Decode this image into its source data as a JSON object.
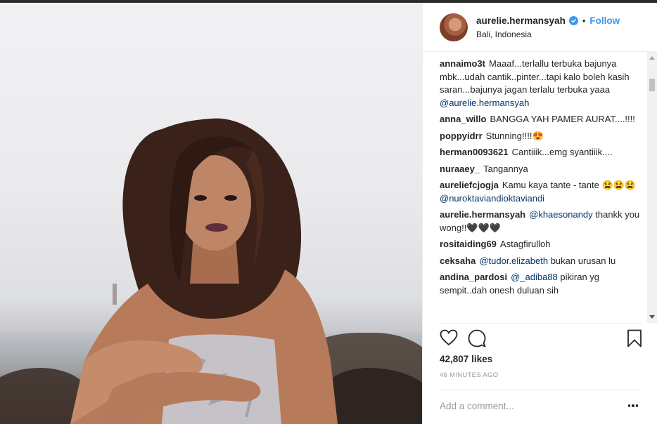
{
  "post": {
    "username": "aurelie.hermansyah",
    "verified_icon": "verified-badge-icon",
    "separator": "•",
    "follow_label": "Follow",
    "location": "Bali, Indonesia"
  },
  "comments": [
    {
      "user": "annaimo3t",
      "text": "Maaaf...terlallu terbuka bajunya mbk...udah cantik..pinter...tapi kalo boleh kasih saran...bajunya jagan terlalu terbuka yaaa ",
      "mention": "@aurelie.hermansyah",
      "after": ""
    },
    {
      "user": "anna_willo",
      "text": "BANGGA YAH PAMER AURAT....!!!!",
      "mention": "",
      "after": ""
    },
    {
      "user": "poppyidrr",
      "text": "Stunning!!!!😍",
      "mention": "",
      "after": ""
    },
    {
      "user": "herman0093621",
      "text": "Cantiiik...emg syantiiik....",
      "mention": "",
      "after": ""
    },
    {
      "user": "nuraaey_",
      "text": "Tangannya",
      "mention": "",
      "after": ""
    },
    {
      "user": "aureliefcjogja",
      "text": "Kamu kaya tante - tante 😫😫😫",
      "mention": "@nuroktaviandioktaviandi",
      "after": ""
    },
    {
      "user": "aurelie.hermansyah",
      "text": "",
      "mention": "@khaesonandy",
      "after": " thankk you wong!!🖤🖤🖤"
    },
    {
      "user": "rositaiding69",
      "text": "Astagfirulloh",
      "mention": "",
      "after": ""
    },
    {
      "user": "ceksaha",
      "text": "",
      "mention": "@tudor.elizabeth",
      "after": " bukan urusan lu"
    },
    {
      "user": "andina_pardosi",
      "text": "",
      "mention": "@_adiba88",
      "after": " pikiran yg sempit..dah onesh duluan sih"
    }
  ],
  "stats": {
    "likes_count": "42,807",
    "likes_label": "likes",
    "time_ago": "46 MINUTES AGO"
  },
  "comment_box": {
    "placeholder": "Add a comment..."
  },
  "colors": {
    "accent": "#3897f0",
    "mention": "#003569",
    "muted": "#999999",
    "border": "#efefef"
  }
}
